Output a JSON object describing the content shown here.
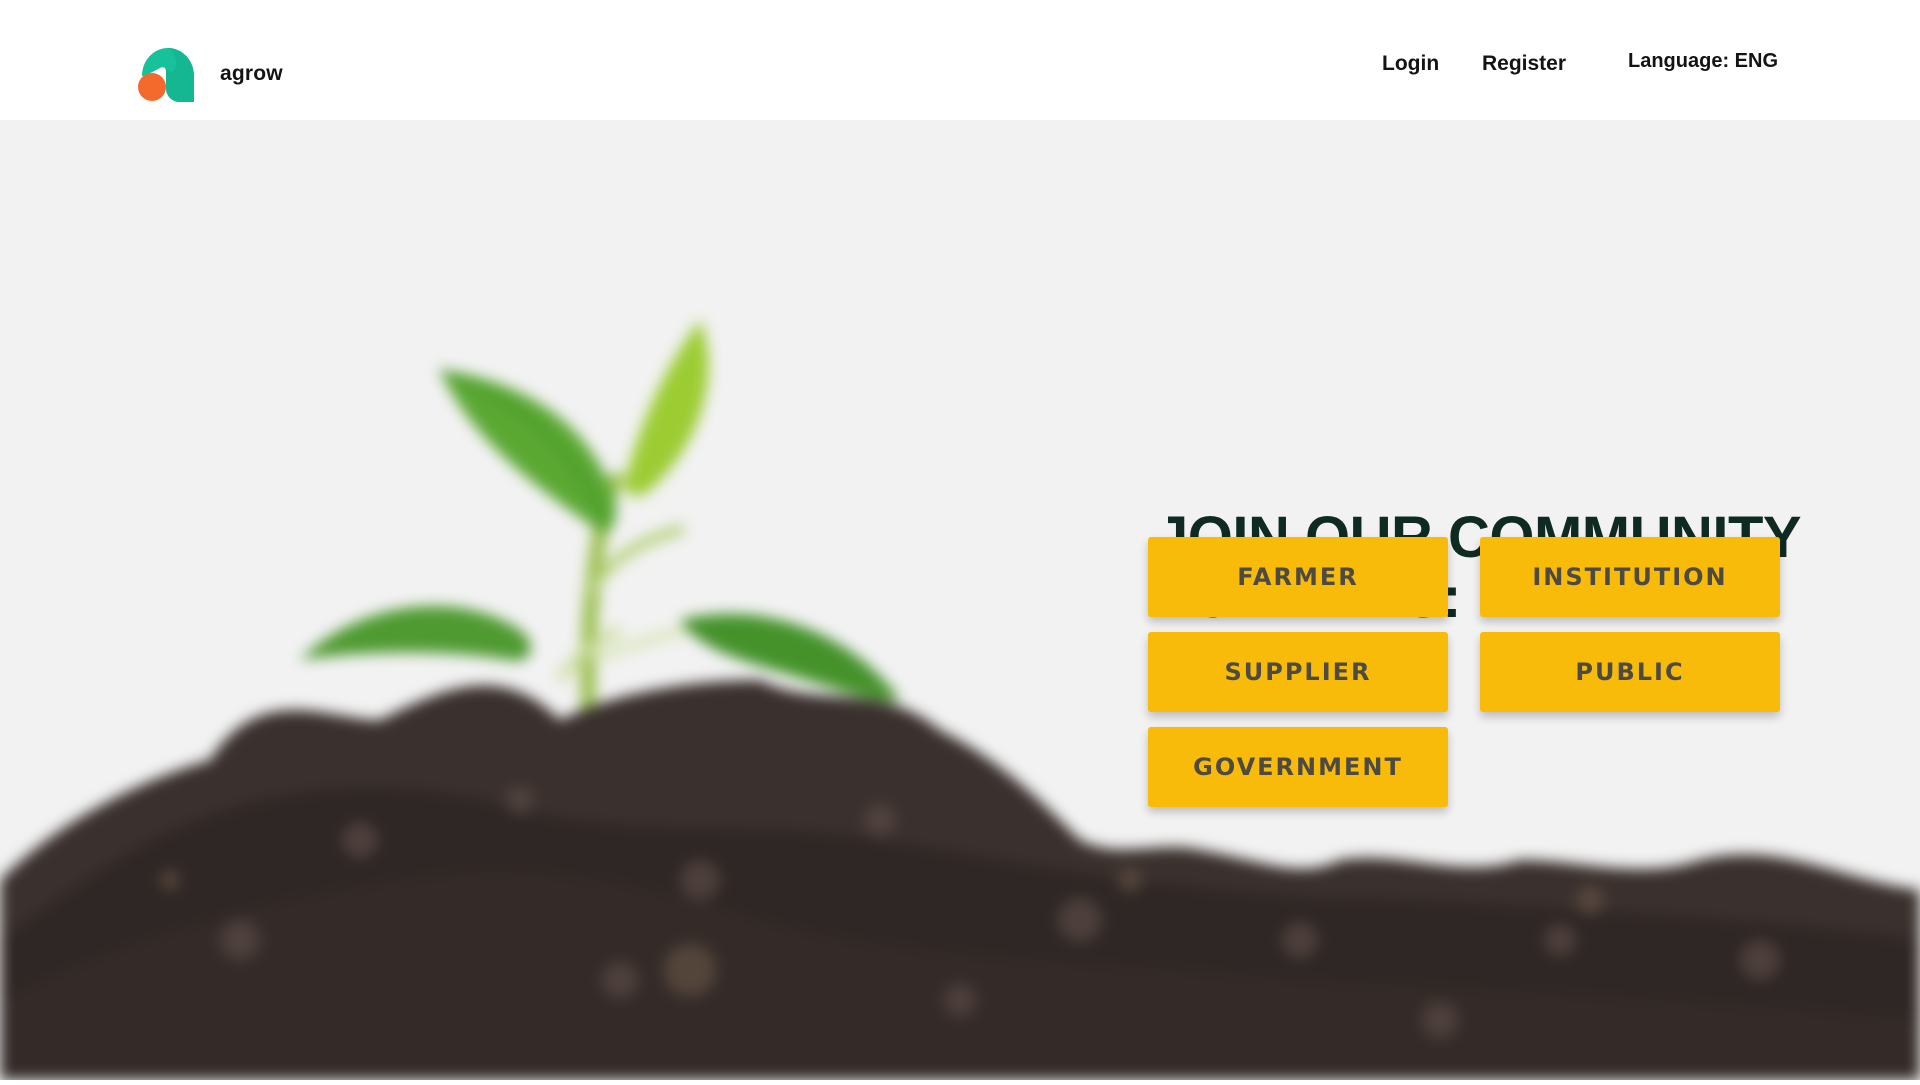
{
  "header": {
    "brand_name": "agrow",
    "nav": {
      "login": "Login",
      "register": "Register",
      "language": "Language: ENG"
    }
  },
  "hero": {
    "heading_line1": "JOIN OUR COMMUNITY",
    "heading_line2": "TODAY AS:",
    "roles": {
      "farmer": "FARMER",
      "institution": "INSTITUTION",
      "supplier": "SUPPLIER",
      "public": "PUBLIC",
      "government": "GOVERNMENT"
    }
  },
  "colors": {
    "brand_teal": "#17c29b",
    "brand_orange": "#f46a2d",
    "button_yellow": "#f8bb09",
    "heading_dark": "#0f2a22",
    "hero_background": "#f2f2f2",
    "soil": "#3a302d"
  },
  "icons": {
    "logo": "agrow-logo-icon",
    "hero_image": "seedling-in-soil-image"
  }
}
